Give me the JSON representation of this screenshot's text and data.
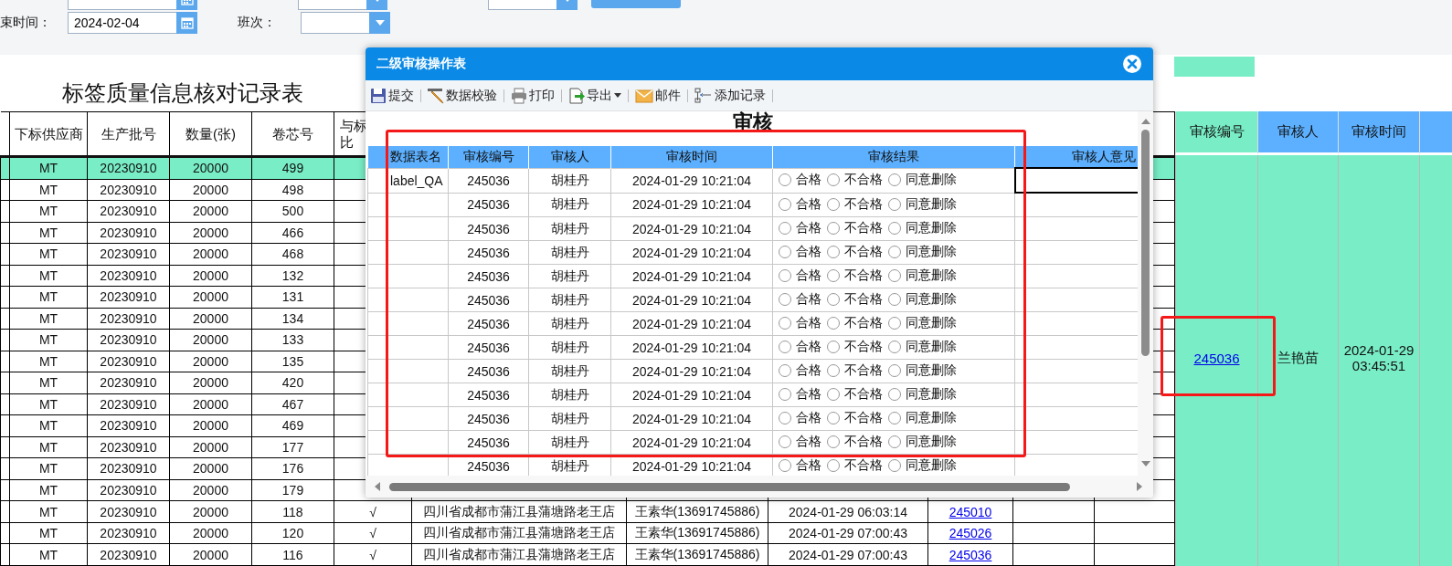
{
  "filters": {
    "row1": [
      {
        "kind": "date"
      },
      {
        "kind": "select"
      },
      {
        "kind": "select"
      },
      {
        "kind": "button"
      }
    ],
    "row2": [
      {
        "kind": "label",
        "text": "束时间："
      },
      {
        "kind": "date",
        "value": "2024-02-04"
      },
      {
        "kind": "label",
        "text": "班次："
      },
      {
        "kind": "select"
      }
    ]
  },
  "page_title": "标签质量信息核对记录表",
  "main_table": {
    "columns": [
      {
        "lines": [
          "下标供应商"
        ]
      },
      {
        "lines": [
          "生产批号"
        ]
      },
      {
        "lines": [
          "数量(张)"
        ]
      },
      {
        "lines": [
          "卷芯号"
        ]
      },
      {
        "lines": [
          "与标",
          "比"
        ]
      }
    ],
    "rows": [
      {
        "selected": true,
        "cells": [
          "MT",
          "20230910",
          "20000",
          "499"
        ]
      },
      {
        "selected": false,
        "cells": [
          "MT",
          "20230910",
          "20000",
          "498"
        ]
      },
      {
        "selected": false,
        "cells": [
          "MT",
          "20230910",
          "20000",
          "500"
        ]
      },
      {
        "selected": false,
        "cells": [
          "MT",
          "20230910",
          "20000",
          "466"
        ]
      },
      {
        "selected": false,
        "cells": [
          "MT",
          "20230910",
          "20000",
          "468"
        ]
      },
      {
        "selected": false,
        "cells": [
          "MT",
          "20230910",
          "20000",
          "132"
        ]
      },
      {
        "selected": false,
        "cells": [
          "MT",
          "20230910",
          "20000",
          "131"
        ]
      },
      {
        "selected": false,
        "cells": [
          "MT",
          "20230910",
          "20000",
          "134"
        ]
      },
      {
        "selected": false,
        "cells": [
          "MT",
          "20230910",
          "20000",
          "133"
        ]
      },
      {
        "selected": false,
        "cells": [
          "MT",
          "20230910",
          "20000",
          "135"
        ]
      },
      {
        "selected": false,
        "cells": [
          "MT",
          "20230910",
          "20000",
          "420"
        ]
      },
      {
        "selected": false,
        "cells": [
          "MT",
          "20230910",
          "20000",
          "467"
        ]
      },
      {
        "selected": false,
        "cells": [
          "MT",
          "20230910",
          "20000",
          "469"
        ]
      },
      {
        "selected": false,
        "cells": [
          "MT",
          "20230910",
          "20000",
          "177"
        ]
      },
      {
        "selected": false,
        "cells": [
          "MT",
          "20230910",
          "20000",
          "176"
        ]
      },
      {
        "selected": false,
        "cells": [
          "MT",
          "20230910",
          "20000",
          "179"
        ]
      },
      {
        "selected": false,
        "cells": [
          "MT",
          "20230910",
          "20000",
          "118",
          "√",
          "四川省成都市蒲江县蒲塘路老王店",
          "王素华(13691745886)",
          "2024-01-29 06:03:14",
          "245010"
        ]
      },
      {
        "selected": false,
        "cells": [
          "MT",
          "20230910",
          "20000",
          "120",
          "√",
          "四川省成都市蒲江县蒲塘路老王店",
          "王素华(13691745886)",
          "2024-01-29 07:00:43",
          "245026"
        ]
      },
      {
        "selected": false,
        "cells": [
          "MT",
          "20230910",
          "20000",
          "116",
          "√",
          "四川省成都市蒲江县蒲塘路老王店",
          "王素华(13691745886)",
          "2024-01-29 07:00:43",
          "245036"
        ]
      }
    ],
    "review": {
      "headers": [
        "审核编号",
        "审核人",
        "审核时间"
      ],
      "number": "245036",
      "reviewer": "兰艳苗",
      "time": "2024-01-29 03:45:51"
    }
  },
  "dialog": {
    "title": "二级审核操作表",
    "toolbar": [
      {
        "kind": "save",
        "label": "提交"
      },
      {
        "kind": "check",
        "label": "数据校验"
      },
      {
        "kind": "print",
        "label": "打印"
      },
      {
        "kind": "export",
        "label": "导出",
        "dropdown": true
      },
      {
        "kind": "mail",
        "label": "邮件"
      },
      {
        "kind": "add",
        "label": "添加记录"
      }
    ],
    "heading": "审核",
    "columns": [
      "数据表名",
      "审核编号",
      "审核人",
      "审核时间",
      "审核结果",
      "审核人意见"
    ],
    "rows": [
      {
        "table": "label_QA",
        "number": "245036",
        "reviewer": "胡桂丹",
        "time": "2024-01-29 10:21:04",
        "editing": true,
        "options": [
          {
            "label": "合格",
            "selected": false
          },
          {
            "label": "不合格",
            "selected": false
          },
          {
            "label": "同意删除",
            "selected": false
          }
        ]
      },
      {
        "number": "245036",
        "reviewer": "胡桂丹",
        "time": "2024-01-29 10:21:04",
        "editing": false,
        "options": [
          {
            "label": "合格",
            "selected": false
          },
          {
            "label": "不合格",
            "selected": false
          },
          {
            "label": "同意删除",
            "selected": false
          }
        ]
      },
      {
        "number": "245036",
        "reviewer": "胡桂丹",
        "time": "2024-01-29 10:21:04",
        "editing": false,
        "options": [
          {
            "label": "合格",
            "selected": false
          },
          {
            "label": "不合格",
            "selected": false
          },
          {
            "label": "同意删除",
            "selected": false
          }
        ]
      },
      {
        "number": "245036",
        "reviewer": "胡桂丹",
        "time": "2024-01-29 10:21:04",
        "editing": false,
        "options": [
          {
            "label": "合格",
            "selected": false
          },
          {
            "label": "不合格",
            "selected": false
          },
          {
            "label": "同意删除",
            "selected": false
          }
        ]
      },
      {
        "number": "245036",
        "reviewer": "胡桂丹",
        "time": "2024-01-29 10:21:04",
        "editing": false,
        "options": [
          {
            "label": "合格",
            "selected": false
          },
          {
            "label": "不合格",
            "selected": false
          },
          {
            "label": "同意删除",
            "selected": false
          }
        ]
      },
      {
        "number": "245036",
        "reviewer": "胡桂丹",
        "time": "2024-01-29 10:21:04",
        "editing": false,
        "options": [
          {
            "label": "合格",
            "selected": false
          },
          {
            "label": "不合格",
            "selected": false
          },
          {
            "label": "同意删除",
            "selected": false
          }
        ]
      },
      {
        "number": "245036",
        "reviewer": "胡桂丹",
        "time": "2024-01-29 10:21:04",
        "editing": false,
        "options": [
          {
            "label": "合格",
            "selected": false
          },
          {
            "label": "不合格",
            "selected": false
          },
          {
            "label": "同意删除",
            "selected": false
          }
        ]
      },
      {
        "number": "245036",
        "reviewer": "胡桂丹",
        "time": "2024-01-29 10:21:04",
        "editing": false,
        "options": [
          {
            "label": "合格",
            "selected": false
          },
          {
            "label": "不合格",
            "selected": false
          },
          {
            "label": "同意删除",
            "selected": false
          }
        ]
      },
      {
        "number": "245036",
        "reviewer": "胡桂丹",
        "time": "2024-01-29 10:21:04",
        "editing": false,
        "options": [
          {
            "label": "合格",
            "selected": false
          },
          {
            "label": "不合格",
            "selected": false
          },
          {
            "label": "同意删除",
            "selected": false
          }
        ]
      },
      {
        "number": "245036",
        "reviewer": "胡桂丹",
        "time": "2024-01-29 10:21:04",
        "editing": false,
        "options": [
          {
            "label": "合格",
            "selected": false
          },
          {
            "label": "不合格",
            "selected": false
          },
          {
            "label": "同意删除",
            "selected": false
          }
        ]
      },
      {
        "number": "245036",
        "reviewer": "胡桂丹",
        "time": "2024-01-29 10:21:04",
        "editing": false,
        "options": [
          {
            "label": "合格",
            "selected": false
          },
          {
            "label": "不合格",
            "selected": false
          },
          {
            "label": "同意删除",
            "selected": false
          }
        ]
      },
      {
        "number": "245036",
        "reviewer": "胡桂丹",
        "time": "2024-01-29 10:21:04",
        "editing": false,
        "options": [
          {
            "label": "合格",
            "selected": false
          },
          {
            "label": "不合格",
            "selected": false
          },
          {
            "label": "同意删除",
            "selected": false
          }
        ]
      },
      {
        "number": "245036",
        "reviewer": "胡桂丹",
        "time": "2024-01-29 10:21:04",
        "editing": false,
        "options": [
          {
            "label": "合格",
            "selected": false
          },
          {
            "label": "不合格",
            "selected": false
          },
          {
            "label": "同意删除",
            "selected": false
          }
        ]
      }
    ]
  }
}
